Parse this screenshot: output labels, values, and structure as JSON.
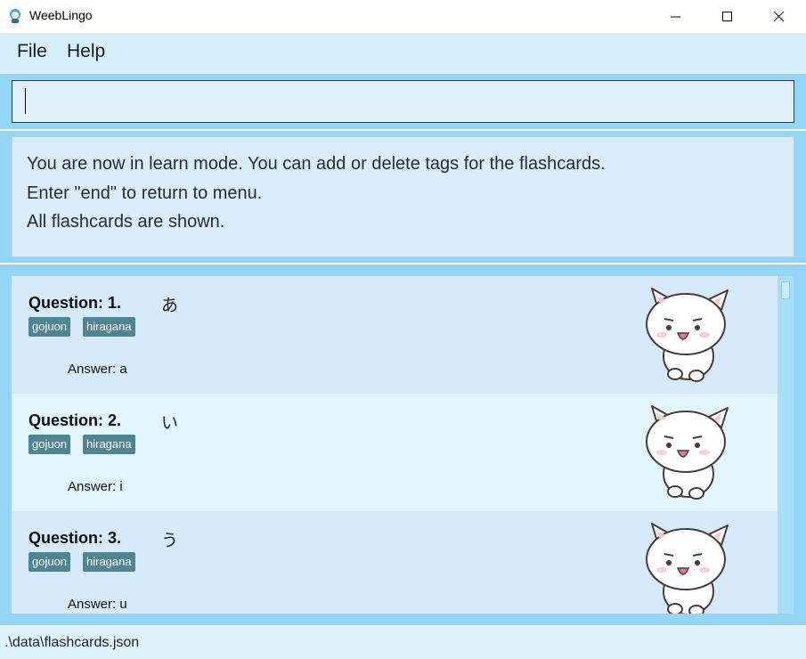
{
  "window": {
    "title": "WeebLingo"
  },
  "menu": {
    "items": [
      "File",
      "Help"
    ]
  },
  "command": {
    "value": "",
    "placeholder": ""
  },
  "result": {
    "lines": [
      "You are now in learn mode. You can add or delete tags for the flashcards.",
      "Enter \"end\" to return to menu.",
      "All flashcards are shown."
    ]
  },
  "flashcards": [
    {
      "question_label": "Question: 1.",
      "question": "あ",
      "tags": [
        "gojuon",
        "hiragana"
      ],
      "answer": "Answer: a",
      "bg": "#d6eafb"
    },
    {
      "question_label": "Question: 2.",
      "question": "い",
      "tags": [
        "gojuon",
        "hiragana"
      ],
      "answer": "Answer: i",
      "bg": "#e2f4fd"
    },
    {
      "question_label": "Question: 3.",
      "question": "う",
      "tags": [
        "gojuon",
        "hiragana"
      ],
      "answer": "Answer: u",
      "bg": "#d6eafb"
    }
  ],
  "status": {
    "path": ".\\data\\flashcards.json"
  },
  "colors": {
    "accent": "#95d6f6",
    "tag": "#4e8593",
    "menu_bg": "#d6effb"
  }
}
